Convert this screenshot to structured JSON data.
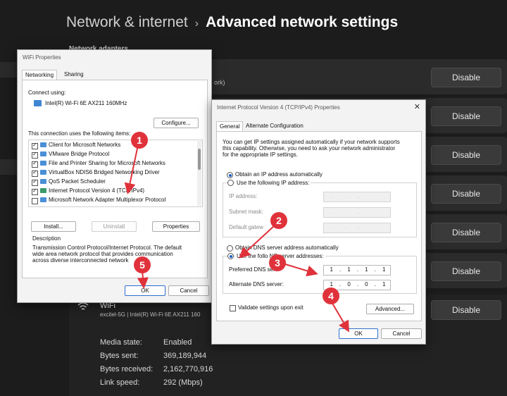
{
  "settings": {
    "breadcrumb_parent": "Network & internet",
    "breadcrumb_current": "Advanced network settings",
    "section_label": "Network adapters",
    "row_sub_fragment": "ork)",
    "disable_label": "Disable",
    "wifi": {
      "name": "WiFi",
      "sub": "excitel-5G | Intel(R) Wi-Fi 6E AX211 160",
      "properties": [
        {
          "label": "Media state:",
          "value": "Enabled"
        },
        {
          "label": "Bytes sent:",
          "value": "369,189,944"
        },
        {
          "label": "Bytes received:",
          "value": "2,162,770,916"
        },
        {
          "label": "Link speed:",
          "value": "292 (Mbps)"
        }
      ]
    }
  },
  "wifi_dialog": {
    "title": "WiFi Properties",
    "tabs": [
      "Networking",
      "Sharing"
    ],
    "connect_using_label": "Connect using:",
    "adapter": "Intel(R) Wi-Fi 6E AX211 160MHz",
    "configure_label": "Configure...",
    "items_label": "This connection uses the following items:",
    "items": [
      {
        "label": "Client for Microsoft Networks",
        "checked": true
      },
      {
        "label": "VMware Bridge Protocol",
        "checked": true
      },
      {
        "label": "File and Printer Sharing for Microsoft Networks",
        "checked": true
      },
      {
        "label": "VirtualBox NDIS6 Bridged Networking Driver",
        "checked": true
      },
      {
        "label": "QoS Packet Scheduler",
        "checked": true
      },
      {
        "label": "Internet Protocol Version 4 (TCP/IPv4)",
        "checked": true
      },
      {
        "label": "Microsoft Network Adapter Multiplexor Protocol",
        "checked": false
      }
    ],
    "install_label": "Install...",
    "uninstall_label": "Uninstall",
    "properties_label": "Properties",
    "description_title": "Description",
    "description_line1": "Transmission Control Protocol/Internet Protocol. The default",
    "description_line2": "wide area network protocol that provides communication",
    "description_line3": "across diverse interconnected network",
    "ok_label": "OK",
    "cancel_label": "Cancel"
  },
  "ipv4_dialog": {
    "title": "Internet Protocol Version 4 (TCP/IPv4) Properties",
    "close_glyph": "✕",
    "tabs": [
      "General",
      "Alternate Configuration"
    ],
    "intro_line1": "You can get IP settings assigned automatically if your network supports",
    "intro_line2": "this capability. Otherwise, you need to ask your network administrator",
    "intro_line3": "for the appropriate IP settings.",
    "obtain_ip_auto": "Obtain an IP address automatically",
    "use_following_ip": "Use the following IP address:",
    "ip_address_label": "IP address:",
    "subnet_label": "Subnet mask:",
    "gateway_label": "Default gatew",
    "obtain_dns_auto": "Obtain DNS server address automatically",
    "use_following_dns": "Use the follo        NS server addresses:",
    "preferred_dns_label": "Preferred DNS serv",
    "alternate_dns_label": "Alternate DNS server:",
    "preferred_dns": [
      "1",
      "1",
      "1",
      "1"
    ],
    "alternate_dns": [
      "1",
      "0",
      "0",
      "1"
    ],
    "validate_label": "Validate settings upon exit",
    "advanced_label": "Advanced...",
    "ok_label": "OK",
    "cancel_label": "Cancel"
  },
  "annotations": {
    "steps": [
      "1",
      "2",
      "3",
      "4",
      "5"
    ],
    "color": "#e0323b"
  }
}
